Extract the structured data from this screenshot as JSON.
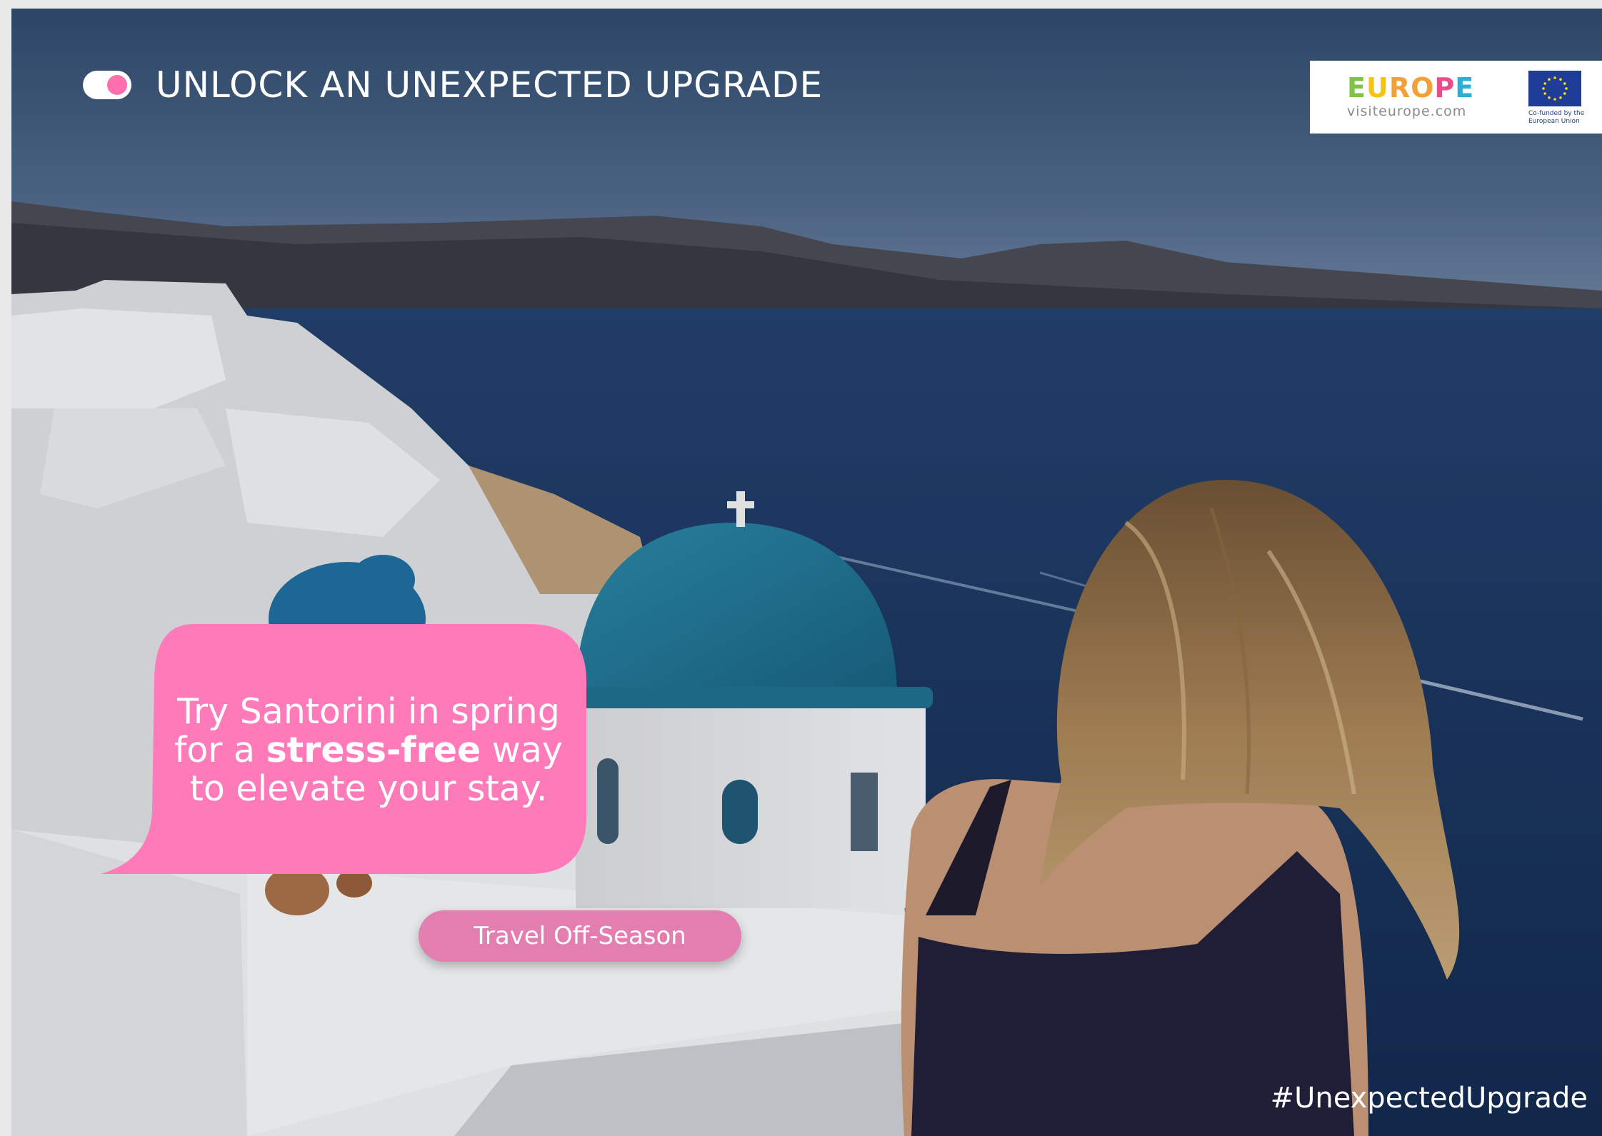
{
  "headline": {
    "text": "UNLOCK AN UNEXPECTED UPGRADE",
    "toggle_state": "on"
  },
  "logo": {
    "wordmark": [
      "E",
      "U",
      "R",
      "O",
      "P",
      "E"
    ],
    "wordmark_colors": [
      "#7fc247",
      "#f5c316",
      "#f2a13a",
      "#f2a13a",
      "#e84e8a",
      "#2ab0d6"
    ],
    "url": "visiteurope.com",
    "eu_caption": "Co-funded by the European Union"
  },
  "bubble": {
    "line1": "Try Santorini in spring",
    "line2_pre": "for a ",
    "line2_bold": "stress-free",
    "line2_post": " way",
    "line3": "to elevate your stay."
  },
  "cta": {
    "label": "Travel Off-Season"
  },
  "hashtag": "#UnexpectedUpgrade",
  "colors": {
    "accent_pink": "#ff7ab8",
    "cta_pink": "#e37eb0",
    "sea": "#1f3a66"
  }
}
